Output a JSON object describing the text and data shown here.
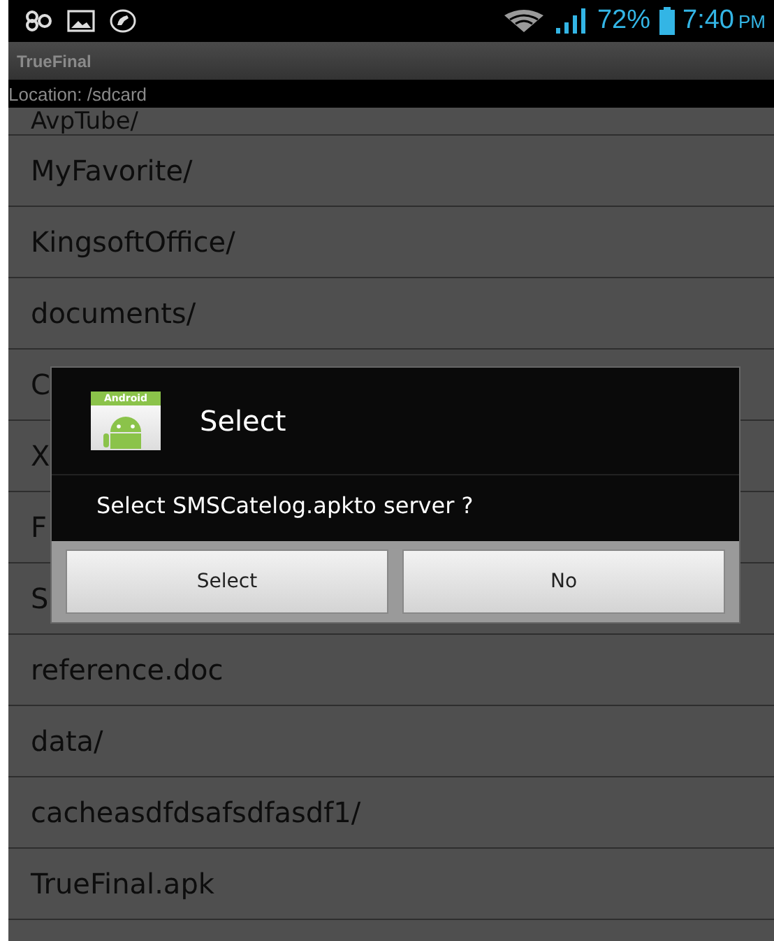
{
  "status_bar": {
    "battery": "72%",
    "time": "7:40",
    "meridiem": "PM"
  },
  "app_title": "TrueFinal",
  "location": "Location: /sdcard",
  "files": [
    {
      "name": "AvpTube/",
      "kind": "cut"
    },
    {
      "name": "MyFavorite/",
      "kind": "full"
    },
    {
      "name": "KingsoftOffice/",
      "kind": "full"
    },
    {
      "name": "documents/",
      "kind": "full"
    },
    {
      "name": "C",
      "kind": "covered"
    },
    {
      "name": "X",
      "kind": "covered"
    },
    {
      "name": "F",
      "kind": "covered"
    },
    {
      "name": "S",
      "kind": "covered"
    },
    {
      "name": "reference.doc",
      "kind": "full"
    },
    {
      "name": "data/",
      "kind": "full"
    },
    {
      "name": "cacheasdfdsafsdfasdf1/",
      "kind": "full"
    },
    {
      "name": "TrueFinal.apk",
      "kind": "full"
    },
    {
      "kind": "empty"
    }
  ],
  "dialog": {
    "icon_label": "Android",
    "title": "Select",
    "message": "Select SMSCatelog.apkto server ?",
    "buttons": [
      "Select",
      "No"
    ]
  }
}
